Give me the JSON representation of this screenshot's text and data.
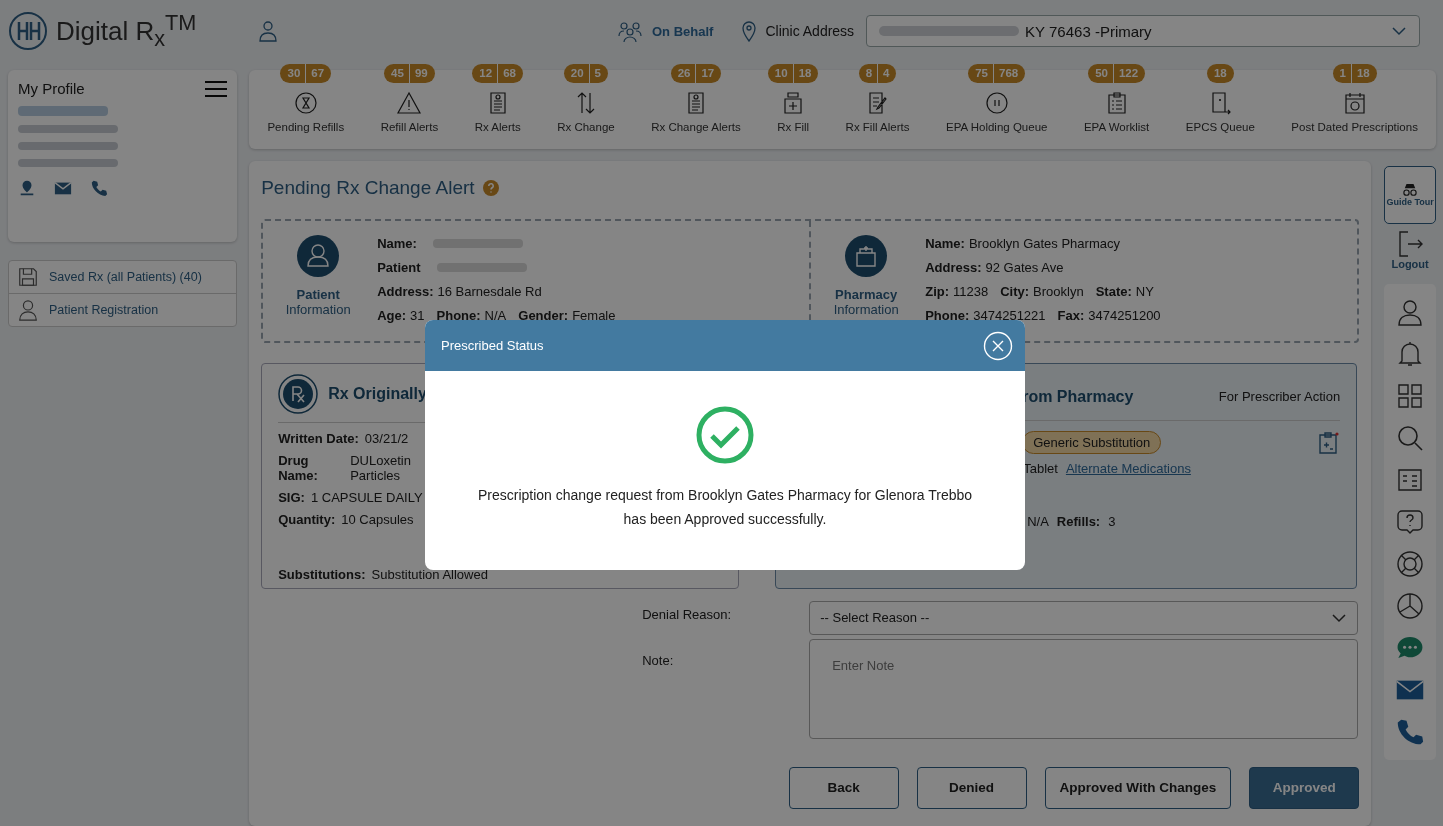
{
  "header": {
    "logo": "Digital R$_{x}$$^{TM}$",
    "on_behalf": "On Behalf",
    "clinic_label": "Clinic Address",
    "clinic_value": "KY 76463 -Primary"
  },
  "profile": {
    "title": "My Profile"
  },
  "side_menu": [
    {
      "kind": "saved",
      "label": "Saved Rx (all Patients) (40)"
    },
    {
      "kind": "patient",
      "label": "Patient Registration"
    }
  ],
  "toolbar": [
    {
      "kind": "refill",
      "label": "Pending Refills",
      "counts": [
        "30",
        "67"
      ]
    },
    {
      "kind": "alert",
      "label": "Refill Alerts",
      "counts": [
        "45",
        "99"
      ]
    },
    {
      "kind": "doc",
      "label": "Rx Alerts",
      "counts": [
        "12",
        "68"
      ]
    },
    {
      "kind": "swap",
      "label": "Rx Change",
      "counts": [
        "20",
        "5"
      ]
    },
    {
      "kind": "doc",
      "label": "Rx Change Alerts",
      "counts": [
        "26",
        "17"
      ]
    },
    {
      "kind": "bottle",
      "label": "Rx Fill",
      "counts": [
        "10",
        "18"
      ]
    },
    {
      "kind": "edit",
      "label": "Rx Fill Alerts",
      "counts": [
        "8",
        "4"
      ]
    },
    {
      "kind": "pause",
      "label": "EPA Holding Queue",
      "counts": [
        "75",
        "768"
      ]
    },
    {
      "kind": "clip",
      "label": "EPA Worklist",
      "counts": [
        "50",
        "122"
      ]
    },
    {
      "kind": "tablet",
      "label": "EPCS Queue",
      "counts": [
        "18"
      ]
    },
    {
      "kind": "calendar",
      "label": "Post Dated Prescriptions",
      "counts": [
        "1",
        "18"
      ]
    }
  ],
  "page_title": "Pending Rx Change Alert",
  "patient": {
    "title": "Patient",
    "subtitle": "Information",
    "lines": [
      [
        {
          "label": "Name:"
        }
      ],
      [
        {
          "label": "Patient"
        }
      ],
      [
        {
          "label": "Address:",
          "value": "16 Barnesdale Rd"
        }
      ],
      [
        {
          "label": "Age:",
          "value": "31"
        },
        {
          "label": "Phone:",
          "value": "N/A"
        },
        {
          "label": "Gender:",
          "value": "Female"
        }
      ]
    ]
  },
  "pharmacy": {
    "title": "Pharmacy",
    "subtitle": "Information",
    "lines": [
      [
        {
          "label": "Name:",
          "value": "Brooklyn Gates Pharmacy"
        }
      ],
      [
        {
          "label": "Address:",
          "value": "92 Gates Ave"
        }
      ],
      [
        {
          "label": "Zip:",
          "value": "11238"
        },
        {
          "label": "City:",
          "value": "Brooklyn"
        },
        {
          "label": "State:",
          "value": "NY"
        }
      ],
      [
        {
          "label": "Phone:",
          "value": "3474251221"
        },
        {
          "label": "Fax:",
          "value": "3474251200"
        }
      ]
    ]
  },
  "original": {
    "title": "Rx Originally",
    "written_label": "Written Date:",
    "written_value": "03/21/2",
    "drug_label": "Drug Name:",
    "drug_value": "DULoxetin",
    "drug_value2": "Particles",
    "sig_label": "SIG:",
    "sig_value": "1 CAPSULE DAILY",
    "qty_label": "Quantity:",
    "qty_value": "10 Capsules",
    "subst_label": "Substitutions:",
    "subst_value": "Substitution Allowed"
  },
  "changed": {
    "title": "rom Pharmacy",
    "action": "For Prescriber Action",
    "badge": "Generic Substitution",
    "form": "Tablet",
    "link": "Alternate Medications",
    "value": "N/A",
    "refills_label": "Refills:",
    "refills_value": "3"
  },
  "denial": {
    "label": "Denial Reason:",
    "select": "-- Select Reason --",
    "note_label": "Note:",
    "note_placeholder": "Enter Note"
  },
  "buttons": [
    {
      "kind": "outline",
      "label": "Back"
    },
    {
      "kind": "outline",
      "label": "Denied"
    },
    {
      "kind": "outline",
      "label": "Approved With Changes"
    },
    {
      "kind": "primary",
      "label": "Approved"
    }
  ],
  "rail": {
    "guide": "Guide Tour",
    "logout": "Logout",
    "icons": [
      {
        "kind": "user"
      },
      {
        "kind": "bell"
      },
      {
        "kind": "grid"
      },
      {
        "kind": "search"
      },
      {
        "kind": "list"
      },
      {
        "kind": "help"
      },
      {
        "kind": "lifebuoy"
      },
      {
        "kind": "pie"
      },
      {
        "kind": "chat"
      },
      {
        "kind": "mail"
      },
      {
        "kind": "phone"
      }
    ]
  },
  "modal": {
    "title": "Prescribed Status",
    "message": "Prescription change request from Brooklyn Gates Pharmacy for Glenora Trebbo has been Approved successfully."
  }
}
